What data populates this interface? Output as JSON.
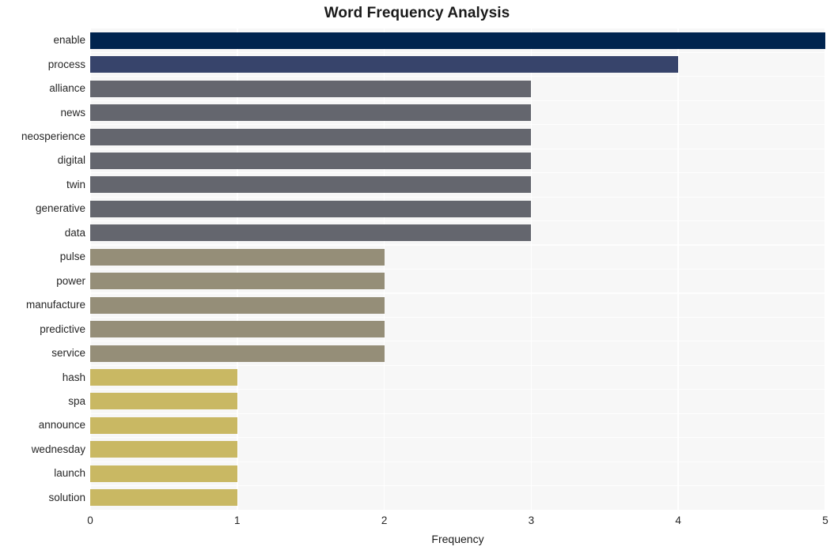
{
  "chart_data": {
    "type": "bar",
    "orientation": "horizontal",
    "title": "Word Frequency Analysis",
    "xlabel": "Frequency",
    "ylabel": "",
    "categories": [
      "enable",
      "process",
      "alliance",
      "news",
      "neosperience",
      "digital",
      "twin",
      "generative",
      "data",
      "pulse",
      "power",
      "manufacture",
      "predictive",
      "service",
      "hash",
      "spa",
      "announce",
      "wednesday",
      "launch",
      "solution"
    ],
    "values": [
      5,
      4,
      3,
      3,
      3,
      3,
      3,
      3,
      3,
      2,
      2,
      2,
      2,
      2,
      1,
      1,
      1,
      1,
      1,
      1
    ],
    "bar_colors": [
      "#00244f",
      "#37446b",
      "#64666e",
      "#64666e",
      "#64666e",
      "#64666e",
      "#64666e",
      "#64666e",
      "#64666e",
      "#958e78",
      "#958e78",
      "#958e78",
      "#958e78",
      "#958e78",
      "#c9b863",
      "#c9b863",
      "#c9b863",
      "#c9b863",
      "#c9b863",
      "#c9b863"
    ],
    "xlim": [
      0,
      5.0
    ],
    "xticks": [
      0,
      1,
      2,
      3,
      4,
      5
    ],
    "xticklabels": [
      "0",
      "1",
      "2",
      "3",
      "4",
      "5"
    ],
    "grid": true,
    "grid_color": "#ffffff",
    "plot_background": "#f7f7f7",
    "figure_background": "#ffffff",
    "legend": null
  }
}
